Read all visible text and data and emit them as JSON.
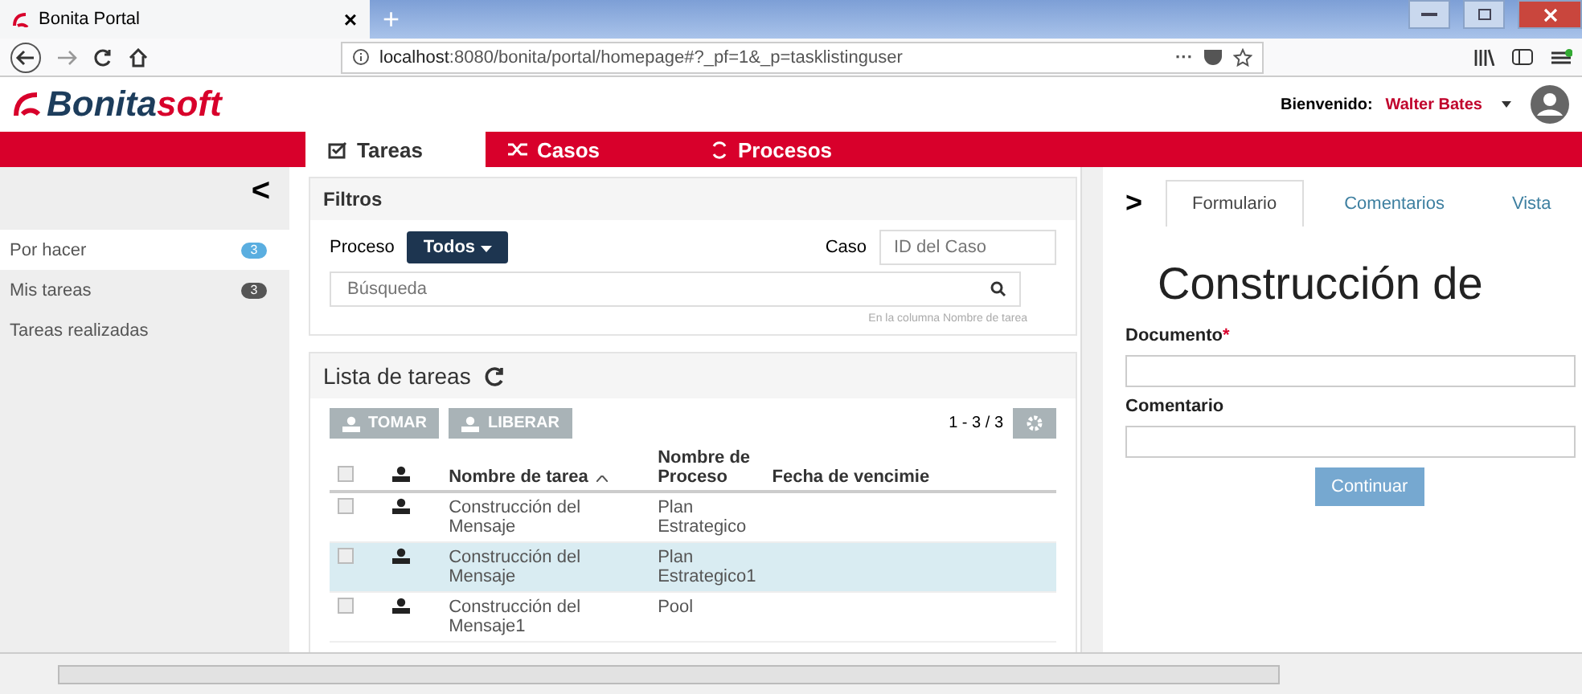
{
  "browser": {
    "tab_title": "Bonita Portal",
    "tab_close": "×",
    "new_tab": "+",
    "url_host": "localhost",
    "url_path": ":8080/bonita/portal/homepage#?_pf=1&_p=tasklistinguser",
    "url_more": "···"
  },
  "header": {
    "logo_bold": "Bonita",
    "logo_light": "soft",
    "welcome": "Bienvenido:",
    "user": "Walter Bates"
  },
  "nav_tabs": [
    {
      "label": "Tareas",
      "selected": true,
      "kind": "check"
    },
    {
      "label": "Casos",
      "selected": false,
      "kind": "shuffle"
    },
    {
      "label": "Procesos",
      "selected": false,
      "kind": "process"
    }
  ],
  "sidebar": {
    "collapse": "<",
    "items": [
      {
        "label": "Por hacer",
        "selected": true,
        "count": "3",
        "color": "#5aaee0"
      },
      {
        "label": "Mis tareas",
        "selected": false,
        "count": "3",
        "color": "#555555"
      },
      {
        "label": "Tareas realizadas",
        "selected": false
      }
    ]
  },
  "filters": {
    "title": "Filtros",
    "process_label": "Proceso",
    "process_value": "Todos",
    "case_label": "Caso",
    "case_placeholder": "ID del Caso",
    "search_placeholder": "Búsqueda",
    "search_hint": "En la columna Nombre de tarea"
  },
  "task_list": {
    "title": "Lista de tareas",
    "take": "TOMAR",
    "release": "LIBERAR",
    "paging": "1 - 3 / 3",
    "select_all_checked": false,
    "columns": [
      "Nombre de tarea",
      "Nombre de Proceso",
      "Fecha de vencimie"
    ],
    "rows": [
      {
        "task": "Construcción del Mensaje",
        "process": "Plan Estrategico",
        "selected": false,
        "checked": false
      },
      {
        "task": "Construcción del Mensaje",
        "process": "Plan Estrategico1",
        "selected": true,
        "checked": false
      },
      {
        "task": "Construcción del Mensaje1",
        "process": "Pool",
        "selected": false,
        "checked": false
      }
    ]
  },
  "detail": {
    "expand": ">",
    "tabs": [
      {
        "label": "Formulario",
        "selected": true
      },
      {
        "label": "Comentarios",
        "selected": false
      },
      {
        "label": "Vista",
        "selected": false
      }
    ],
    "title": "Construcción de",
    "required_mark": "*",
    "fields": [
      {
        "label": "Documento",
        "required": true
      },
      {
        "label": "Comentario",
        "required": false
      }
    ],
    "submit": "Continuar"
  }
}
